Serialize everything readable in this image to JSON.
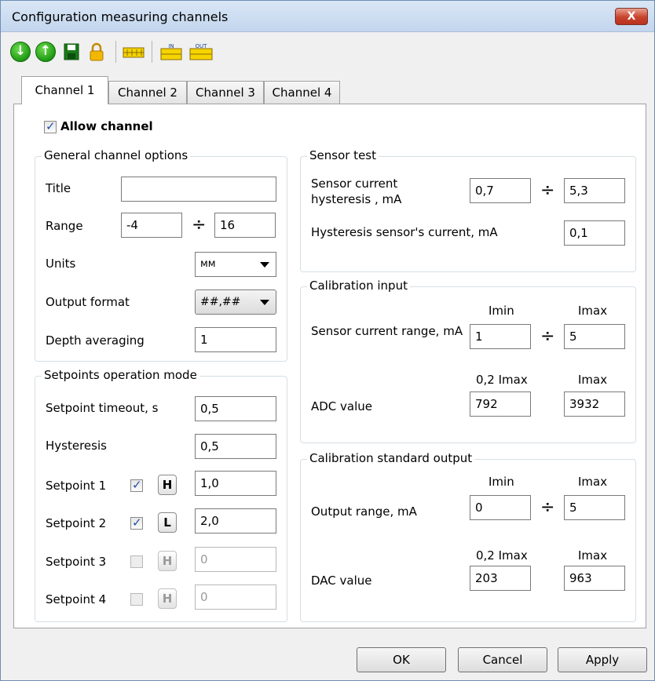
{
  "window": {
    "title": "Configuration  measuring channels",
    "close_label": "X"
  },
  "toolbar": {
    "items": [
      {
        "icon": "arrow-down-circle-icon",
        "glyph": "↓"
      },
      {
        "icon": "arrow-up-circle-icon",
        "glyph": "↑"
      },
      {
        "icon": "save-icon"
      },
      {
        "icon": "lock-icon"
      },
      {
        "icon": "scale-icon"
      },
      {
        "icon": "input-scale-icon",
        "text": "IN"
      },
      {
        "icon": "output-scale-icon",
        "text": "OUT"
      }
    ]
  },
  "tabs": [
    "Channel 1",
    "Channel 2",
    "Channel 3",
    "Channel 4"
  ],
  "allow_channel": {
    "label": "Allow channel",
    "checked": true
  },
  "general": {
    "title": "General channel options",
    "title_label": "Title",
    "title_value": "",
    "range_label": "Range",
    "range_from": "-4",
    "range_sep": "÷",
    "range_to": "16",
    "units_label": "Units",
    "units_value": "мм",
    "output_format_label": "Output format",
    "output_format_value": "##,##",
    "depth_label": "Depth averaging",
    "depth_value": "1"
  },
  "setpoints": {
    "title": "Setpoints operation mode",
    "timeout_label": "Setpoint timeout, s",
    "timeout_value": "0,5",
    "hysteresis_label": "Hysteresis",
    "hysteresis_value": "0,5",
    "items": [
      {
        "label": "Setpoint 1",
        "checked": true,
        "mode": "H",
        "value": "1,0",
        "enabled": true
      },
      {
        "label": "Setpoint 2",
        "checked": true,
        "mode": "L",
        "value": "2,0",
        "enabled": true
      },
      {
        "label": "Setpoint 3",
        "checked": false,
        "mode": "H",
        "value": "0",
        "enabled": false
      },
      {
        "label": "Setpoint 4",
        "checked": false,
        "mode": "H",
        "value": "0",
        "enabled": false
      }
    ]
  },
  "sensor_test": {
    "title": "Sensor test",
    "current_label_1": "Sensor current",
    "current_label_2": "hysteresis , mA",
    "current_from": "0,7",
    "current_sep": "÷",
    "current_to": "5,3",
    "hyst_label": "Hysteresis sensor's current, mA",
    "hyst_value": "0,1"
  },
  "calib_input": {
    "title": "Calibration input",
    "imin_label": "Imin",
    "imax_label": "Imax",
    "range_label": "Sensor current range, mA",
    "range_from": "1",
    "range_sep": "÷",
    "range_to": "5",
    "low_label": "0,2 Imax",
    "high_label": "Imax",
    "adc_label": "ADC value",
    "adc_low": "792",
    "adc_high": "3932"
  },
  "calib_output": {
    "title": "Calibration standard output",
    "imin_label": "Imin",
    "imax_label": "Imax",
    "range_label": "Output range, mA",
    "range_from": "0",
    "range_sep": "÷",
    "range_to": "5",
    "low_label": "0,2 Imax",
    "high_label": "Imax",
    "dac_label": "DAC value",
    "dac_low": "203",
    "dac_high": "963"
  },
  "buttons": {
    "ok": "OK",
    "cancel": "Cancel",
    "apply": "Apply"
  }
}
